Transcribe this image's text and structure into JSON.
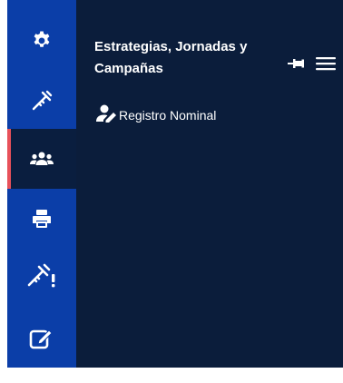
{
  "rail": {
    "items": [
      {
        "icon": "gear-icon",
        "active": false
      },
      {
        "icon": "syringe-icon",
        "active": false
      },
      {
        "icon": "users-icon",
        "active": true
      },
      {
        "icon": "printer-icon",
        "active": false
      },
      {
        "icon": "syringe-alert-icon",
        "active": false
      },
      {
        "icon": "edit-icon",
        "active": false
      }
    ]
  },
  "panel": {
    "title": "Estrategias, Jornadas y Campañas",
    "pin_icon": "pin-icon",
    "menu_icon": "hamburger-icon",
    "links": [
      {
        "label": "Registro Nominal",
        "icon": "user-edit-icon"
      }
    ]
  },
  "colors": {
    "rail_bg": "#0b3ea8",
    "panel_bg": "#0b1d3b",
    "active_indicator": "#e8515a",
    "text": "#ffffff"
  }
}
